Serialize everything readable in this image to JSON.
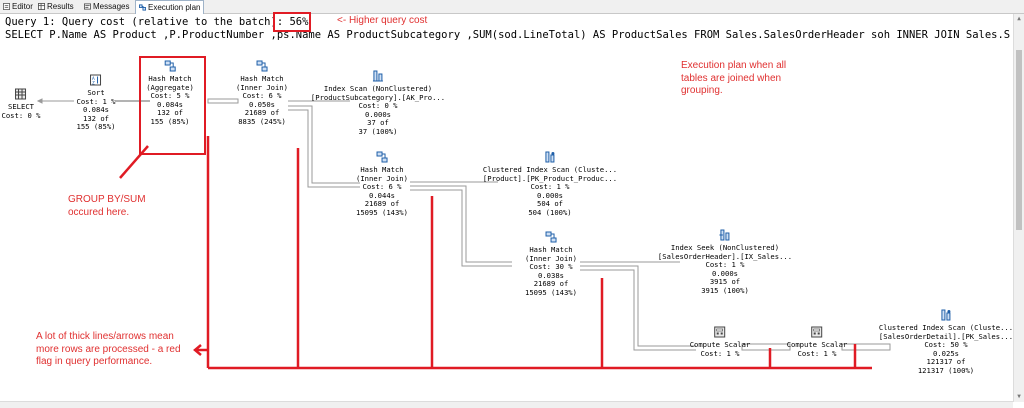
{
  "tabs": [
    {
      "label": "Editor",
      "icon": "editor-icon",
      "active": false
    },
    {
      "label": "Results",
      "icon": "grid-icon",
      "active": false
    },
    {
      "label": "Messages",
      "icon": "messages-icon",
      "active": false
    },
    {
      "label": "Execution plan",
      "icon": "execution-plan-icon",
      "active": true
    }
  ],
  "query": {
    "header_prefix": "Query 1: Query cost (relative to the batch): ",
    "cost": "56%",
    "sql": "SELECT P.Name AS Product ,P.ProductNumber ,ps.Name AS ProductSubcategory ,SUM(sod.LineTotal) AS ProductSales FROM Sales.SalesOrderHeader soh INNER JOIN Sales.S..."
  },
  "nodes": {
    "select": {
      "lines": [
        "SELECT",
        "Cost: 0 %"
      ],
      "icon": "select-icon"
    },
    "sort": {
      "lines": [
        "Sort",
        "Cost: 1 %",
        "0.084s",
        "132 of",
        "155 (85%)"
      ],
      "icon": "sort-icon"
    },
    "hash_agg": {
      "lines": [
        "Hash Match",
        "(Aggregate)",
        "Cost: 5 %",
        "0.084s",
        "132 of",
        "155 (85%)"
      ],
      "icon": "hash-match-icon"
    },
    "hash_join1": {
      "lines": [
        "Hash Match",
        "(Inner Join)",
        "Cost: 6 %",
        "0.050s",
        "21689 of",
        "8835 (245%)"
      ],
      "icon": "hash-match-icon"
    },
    "index_scan_ps": {
      "lines": [
        "Index Scan (NonClustered)",
        "[ProductSubcategory].[AK_Pro...",
        "Cost: 0 %",
        "0.000s",
        "37 of",
        "37 (100%)"
      ],
      "icon": "index-scan-icon"
    },
    "hash_join2": {
      "lines": [
        "Hash Match",
        "(Inner Join)",
        "Cost: 6 %",
        "0.044s",
        "21689 of",
        "15095 (143%)"
      ],
      "icon": "hash-match-icon"
    },
    "clustered_product": {
      "lines": [
        "Clustered Index Scan (Cluste...",
        "[Product].[PK_Product_Produc...",
        "Cost: 1 %",
        "0.000s",
        "504 of",
        "504 (100%)"
      ],
      "icon": "clustered-index-scan-icon"
    },
    "hash_join3": {
      "lines": [
        "Hash Match",
        "(Inner Join)",
        "Cost: 30 %",
        "0.038s",
        "21689 of",
        "15095 (143%)"
      ],
      "icon": "hash-match-icon"
    },
    "index_seek": {
      "lines": [
        "Index Seek (NonClustered)",
        "[SalesOrderHeader].[IX_Sales...",
        "Cost: 1 %",
        "0.000s",
        "3915 of",
        "3915 (100%)"
      ],
      "icon": "index-seek-icon"
    },
    "compute1": {
      "lines": [
        "Compute Scalar",
        "Cost: 1 %"
      ],
      "icon": "compute-scalar-icon"
    },
    "compute2": {
      "lines": [
        "Compute Scalar",
        "Cost: 1 %"
      ],
      "icon": "compute-scalar-icon"
    },
    "clustered_sod": {
      "lines": [
        "Clustered Index Scan (Cluste...",
        "[SalesOrderDetail].[PK_Sales...",
        "Cost: 50 %",
        "0.025s",
        "121317 of",
        "121317 (100%)"
      ],
      "icon": "clustered-index-scan-icon"
    }
  },
  "annotations": {
    "higher_cost": "<- Higher query cost",
    "exec_plan_lines": [
      "Execution plan when all",
      "tables are joined when",
      "grouping."
    ],
    "group_by_lines": [
      "GROUP BY/SUM",
      "occured here."
    ],
    "thick_lines": [
      "A lot of thick lines/arrows mean",
      "more rows are processed - a red",
      "flag in query performance."
    ]
  },
  "colors": {
    "annotation_red": "#e03030",
    "box_red": "#e01b24",
    "icon_blue": "#1f5fa8"
  }
}
